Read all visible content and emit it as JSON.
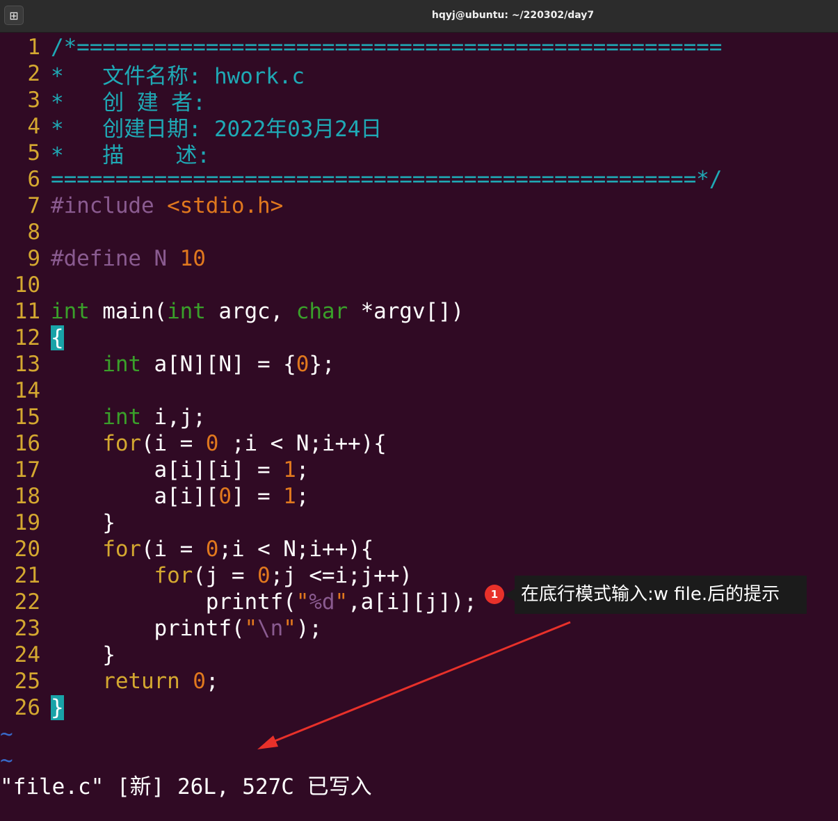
{
  "window": {
    "title": "hqyj@ubuntu: ~/220302/day7",
    "new_tab_glyph": "⊞"
  },
  "editor": {
    "lines": [
      {
        "n": "1",
        "segs": [
          [
            "c-cmt",
            "/*=================================================="
          ]
        ]
      },
      {
        "n": "2",
        "segs": [
          [
            "c-cmt",
            "*   文件名称: hwork.c"
          ]
        ]
      },
      {
        "n": "3",
        "segs": [
          [
            "c-cmt",
            "*   创 建 者:"
          ]
        ]
      },
      {
        "n": "4",
        "segs": [
          [
            "c-cmt",
            "*   创建日期: 2022年03月24日"
          ]
        ]
      },
      {
        "n": "5",
        "segs": [
          [
            "c-cmt",
            "*   描    述:"
          ]
        ]
      },
      {
        "n": "6",
        "segs": [
          [
            "c-cmt",
            "==================================================*/"
          ]
        ]
      },
      {
        "n": "7",
        "segs": [
          [
            "c-pre",
            "#include "
          ],
          [
            "c-str",
            "<stdio.h>"
          ]
        ]
      },
      {
        "n": "8",
        "segs": []
      },
      {
        "n": "9",
        "segs": [
          [
            "c-pre",
            "#define N "
          ],
          [
            "c-num",
            "10"
          ]
        ]
      },
      {
        "n": "10",
        "segs": []
      },
      {
        "n": "11",
        "segs": [
          [
            "c-type",
            "int"
          ],
          [
            "c-txt",
            " main("
          ],
          [
            "c-type",
            "int"
          ],
          [
            "c-txt",
            " argc, "
          ],
          [
            "c-type",
            "char"
          ],
          [
            "c-txt",
            " *argv[])"
          ]
        ]
      },
      {
        "n": "12",
        "segs": [
          [
            "brace",
            "{"
          ]
        ]
      },
      {
        "n": "13",
        "segs": [
          [
            "c-txt",
            "    "
          ],
          [
            "c-type",
            "int"
          ],
          [
            "c-txt",
            " a[N][N] = {"
          ],
          [
            "c-num",
            "0"
          ],
          [
            "c-txt",
            "};"
          ]
        ]
      },
      {
        "n": "14",
        "segs": []
      },
      {
        "n": "15",
        "segs": [
          [
            "c-txt",
            "    "
          ],
          [
            "c-type",
            "int"
          ],
          [
            "c-txt",
            " i,j;"
          ]
        ]
      },
      {
        "n": "16",
        "segs": [
          [
            "c-txt",
            "    "
          ],
          [
            "c-kw",
            "for"
          ],
          [
            "c-txt",
            "(i = "
          ],
          [
            "c-num",
            "0"
          ],
          [
            "c-txt",
            " ;i < N;i++){"
          ]
        ]
      },
      {
        "n": "17",
        "segs": [
          [
            "c-txt",
            "        a[i][i] = "
          ],
          [
            "c-num",
            "1"
          ],
          [
            "c-txt",
            ";"
          ]
        ]
      },
      {
        "n": "18",
        "segs": [
          [
            "c-txt",
            "        a[i]["
          ],
          [
            "c-num",
            "0"
          ],
          [
            "c-txt",
            "] = "
          ],
          [
            "c-num",
            "1"
          ],
          [
            "c-txt",
            ";"
          ]
        ]
      },
      {
        "n": "19",
        "segs": [
          [
            "c-txt",
            "    }"
          ]
        ]
      },
      {
        "n": "20",
        "segs": [
          [
            "c-txt",
            "    "
          ],
          [
            "c-kw",
            "for"
          ],
          [
            "c-txt",
            "(i = "
          ],
          [
            "c-num",
            "0"
          ],
          [
            "c-txt",
            ";i < N;i++){"
          ]
        ]
      },
      {
        "n": "21",
        "segs": [
          [
            "c-txt",
            "        "
          ],
          [
            "c-kw",
            "for"
          ],
          [
            "c-txt",
            "(j = "
          ],
          [
            "c-num",
            "0"
          ],
          [
            "c-txt",
            ";j <=i;j++)"
          ]
        ]
      },
      {
        "n": "22",
        "segs": [
          [
            "c-txt",
            "            printf("
          ],
          [
            "c-str",
            "\""
          ],
          [
            "c-spc",
            "%d"
          ],
          [
            "c-str",
            "\""
          ],
          [
            "c-txt",
            ",a[i][j]);"
          ]
        ]
      },
      {
        "n": "23",
        "segs": [
          [
            "c-txt",
            "        printf("
          ],
          [
            "c-str",
            "\""
          ],
          [
            "c-spc",
            "\\n"
          ],
          [
            "c-str",
            "\""
          ],
          [
            "c-txt",
            ");"
          ]
        ]
      },
      {
        "n": "24",
        "segs": [
          [
            "c-txt",
            "    }"
          ]
        ]
      },
      {
        "n": "25",
        "segs": [
          [
            "c-txt",
            "    "
          ],
          [
            "c-kw",
            "return"
          ],
          [
            "c-txt",
            " "
          ],
          [
            "c-num",
            "0"
          ],
          [
            "c-txt",
            ";"
          ]
        ]
      },
      {
        "n": "26",
        "segs": [
          [
            "brace",
            "}"
          ]
        ]
      }
    ],
    "tilde_lines": [
      "~",
      "~"
    ]
  },
  "status_line": "\"file.c\" [新] 26L, 527C 已写入",
  "annotation": {
    "badge": "1",
    "text": "在底行模式输入:w file.后的提示",
    "color": "#e8312a"
  },
  "colors": {
    "background": "#300a24",
    "comment": "#1fa9b5",
    "line_number": "#d4a830"
  }
}
